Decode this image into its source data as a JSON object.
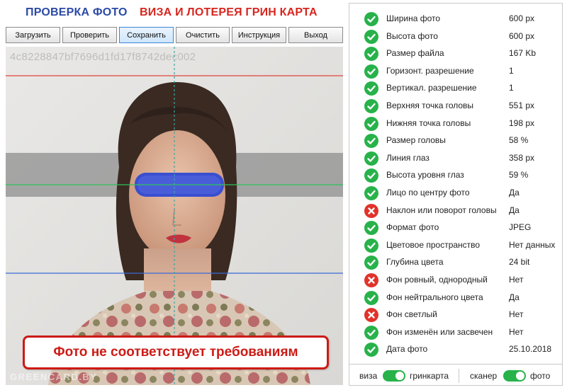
{
  "header": {
    "title_left": "ПРОВЕРКА ФОТО",
    "title_right": "ВИЗА И ЛОТЕРЕЯ ГРИН КАРТА"
  },
  "toolbar": {
    "load": "Загрузить",
    "check": "Проверить",
    "save": "Сохранить",
    "clear": "Очистить",
    "instruction": "Инструкция",
    "exit": "Выход"
  },
  "photo": {
    "hash": "4c8228847bf7696d1fd17f8742dec002",
    "watermark": "GREENCARD.BY",
    "verdict": "Фото не соответствует требованиям"
  },
  "results": [
    {
      "label": "Ширина фото",
      "value": "600 px",
      "ok": true
    },
    {
      "label": "Высота фото",
      "value": "600 px",
      "ok": true
    },
    {
      "label": "Размер файла",
      "value": "167 Kb",
      "ok": true
    },
    {
      "label": "Горизонт. разрешение",
      "value": "1",
      "ok": true
    },
    {
      "label": "Вертикал. разрешение",
      "value": "1",
      "ok": true
    },
    {
      "label": "Верхняя точка головы",
      "value": "551 px",
      "ok": true
    },
    {
      "label": "Нижняя точка головы",
      "value": "198 px",
      "ok": true
    },
    {
      "label": "Размер головы",
      "value": "58 %",
      "ok": true
    },
    {
      "label": "Линия глаз",
      "value": "358 px",
      "ok": true
    },
    {
      "label": "Высота уровня глаз",
      "value": "59 %",
      "ok": true
    },
    {
      "label": "Лицо по центру фото",
      "value": "Да",
      "ok": true
    },
    {
      "label": "Наклон или поворот головы",
      "value": "Да",
      "ok": false
    },
    {
      "label": "Формат фото",
      "value": "JPEG",
      "ok": true
    },
    {
      "label": "Цветовое пространство",
      "value": "Нет данных",
      "ok": true
    },
    {
      "label": "Глубина цвета",
      "value": "24 bit",
      "ok": true
    },
    {
      "label": "Фон ровный, однородный",
      "value": "Нет",
      "ok": false
    },
    {
      "label": "Фон нейтрального цвета",
      "value": "Да",
      "ok": true
    },
    {
      "label": "Фон светлый",
      "value": "Нет",
      "ok": false
    },
    {
      "label": "Фон изменён или засвечен",
      "value": "Нет",
      "ok": true
    },
    {
      "label": "Дата фото",
      "value": "25.10.2018",
      "ok": true
    }
  ],
  "toggles": {
    "left_off": "виза",
    "left_on": "гринкарта",
    "right_off": "сканер",
    "right_on": "фото"
  },
  "colors": {
    "ok": "#27b24a",
    "fail": "#e0332b",
    "title_blue": "#2b4aa6",
    "title_red": "#d7261e"
  }
}
